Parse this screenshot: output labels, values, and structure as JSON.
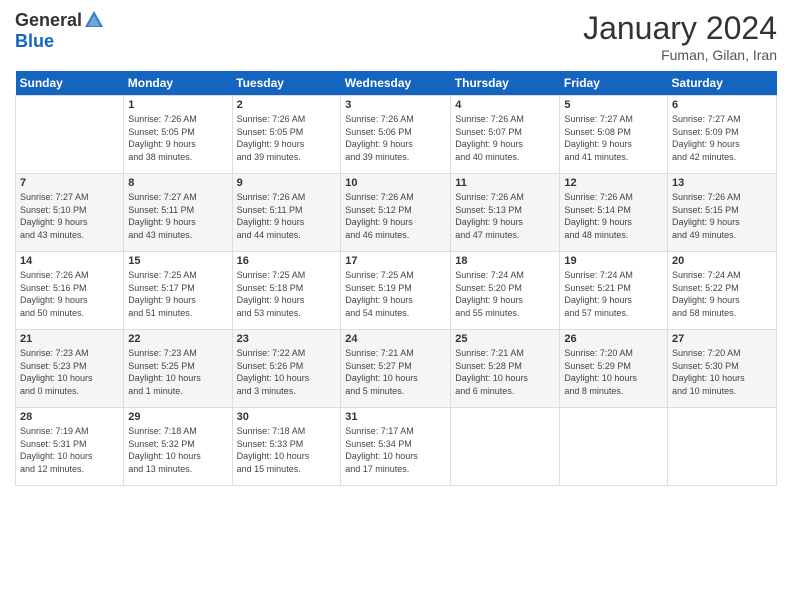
{
  "header": {
    "logo_general": "General",
    "logo_blue": "Blue",
    "month_title": "January 2024",
    "subtitle": "Fuman, Gilan, Iran"
  },
  "days_of_week": [
    "Sunday",
    "Monday",
    "Tuesday",
    "Wednesday",
    "Thursday",
    "Friday",
    "Saturday"
  ],
  "weeks": [
    [
      {
        "number": "",
        "info": ""
      },
      {
        "number": "1",
        "info": "Sunrise: 7:26 AM\nSunset: 5:05 PM\nDaylight: 9 hours\nand 38 minutes."
      },
      {
        "number": "2",
        "info": "Sunrise: 7:26 AM\nSunset: 5:05 PM\nDaylight: 9 hours\nand 39 minutes."
      },
      {
        "number": "3",
        "info": "Sunrise: 7:26 AM\nSunset: 5:06 PM\nDaylight: 9 hours\nand 39 minutes."
      },
      {
        "number": "4",
        "info": "Sunrise: 7:26 AM\nSunset: 5:07 PM\nDaylight: 9 hours\nand 40 minutes."
      },
      {
        "number": "5",
        "info": "Sunrise: 7:27 AM\nSunset: 5:08 PM\nDaylight: 9 hours\nand 41 minutes."
      },
      {
        "number": "6",
        "info": "Sunrise: 7:27 AM\nSunset: 5:09 PM\nDaylight: 9 hours\nand 42 minutes."
      }
    ],
    [
      {
        "number": "7",
        "info": "Sunrise: 7:27 AM\nSunset: 5:10 PM\nDaylight: 9 hours\nand 43 minutes."
      },
      {
        "number": "8",
        "info": "Sunrise: 7:27 AM\nSunset: 5:11 PM\nDaylight: 9 hours\nand 43 minutes."
      },
      {
        "number": "9",
        "info": "Sunrise: 7:26 AM\nSunset: 5:11 PM\nDaylight: 9 hours\nand 44 minutes."
      },
      {
        "number": "10",
        "info": "Sunrise: 7:26 AM\nSunset: 5:12 PM\nDaylight: 9 hours\nand 46 minutes."
      },
      {
        "number": "11",
        "info": "Sunrise: 7:26 AM\nSunset: 5:13 PM\nDaylight: 9 hours\nand 47 minutes."
      },
      {
        "number": "12",
        "info": "Sunrise: 7:26 AM\nSunset: 5:14 PM\nDaylight: 9 hours\nand 48 minutes."
      },
      {
        "number": "13",
        "info": "Sunrise: 7:26 AM\nSunset: 5:15 PM\nDaylight: 9 hours\nand 49 minutes."
      }
    ],
    [
      {
        "number": "14",
        "info": "Sunrise: 7:26 AM\nSunset: 5:16 PM\nDaylight: 9 hours\nand 50 minutes."
      },
      {
        "number": "15",
        "info": "Sunrise: 7:25 AM\nSunset: 5:17 PM\nDaylight: 9 hours\nand 51 minutes."
      },
      {
        "number": "16",
        "info": "Sunrise: 7:25 AM\nSunset: 5:18 PM\nDaylight: 9 hours\nand 53 minutes."
      },
      {
        "number": "17",
        "info": "Sunrise: 7:25 AM\nSunset: 5:19 PM\nDaylight: 9 hours\nand 54 minutes."
      },
      {
        "number": "18",
        "info": "Sunrise: 7:24 AM\nSunset: 5:20 PM\nDaylight: 9 hours\nand 55 minutes."
      },
      {
        "number": "19",
        "info": "Sunrise: 7:24 AM\nSunset: 5:21 PM\nDaylight: 9 hours\nand 57 minutes."
      },
      {
        "number": "20",
        "info": "Sunrise: 7:24 AM\nSunset: 5:22 PM\nDaylight: 9 hours\nand 58 minutes."
      }
    ],
    [
      {
        "number": "21",
        "info": "Sunrise: 7:23 AM\nSunset: 5:23 PM\nDaylight: 10 hours\nand 0 minutes."
      },
      {
        "number": "22",
        "info": "Sunrise: 7:23 AM\nSunset: 5:25 PM\nDaylight: 10 hours\nand 1 minute."
      },
      {
        "number": "23",
        "info": "Sunrise: 7:22 AM\nSunset: 5:26 PM\nDaylight: 10 hours\nand 3 minutes."
      },
      {
        "number": "24",
        "info": "Sunrise: 7:21 AM\nSunset: 5:27 PM\nDaylight: 10 hours\nand 5 minutes."
      },
      {
        "number": "25",
        "info": "Sunrise: 7:21 AM\nSunset: 5:28 PM\nDaylight: 10 hours\nand 6 minutes."
      },
      {
        "number": "26",
        "info": "Sunrise: 7:20 AM\nSunset: 5:29 PM\nDaylight: 10 hours\nand 8 minutes."
      },
      {
        "number": "27",
        "info": "Sunrise: 7:20 AM\nSunset: 5:30 PM\nDaylight: 10 hours\nand 10 minutes."
      }
    ],
    [
      {
        "number": "28",
        "info": "Sunrise: 7:19 AM\nSunset: 5:31 PM\nDaylight: 10 hours\nand 12 minutes."
      },
      {
        "number": "29",
        "info": "Sunrise: 7:18 AM\nSunset: 5:32 PM\nDaylight: 10 hours\nand 13 minutes."
      },
      {
        "number": "30",
        "info": "Sunrise: 7:18 AM\nSunset: 5:33 PM\nDaylight: 10 hours\nand 15 minutes."
      },
      {
        "number": "31",
        "info": "Sunrise: 7:17 AM\nSunset: 5:34 PM\nDaylight: 10 hours\nand 17 minutes."
      },
      {
        "number": "",
        "info": ""
      },
      {
        "number": "",
        "info": ""
      },
      {
        "number": "",
        "info": ""
      }
    ]
  ]
}
